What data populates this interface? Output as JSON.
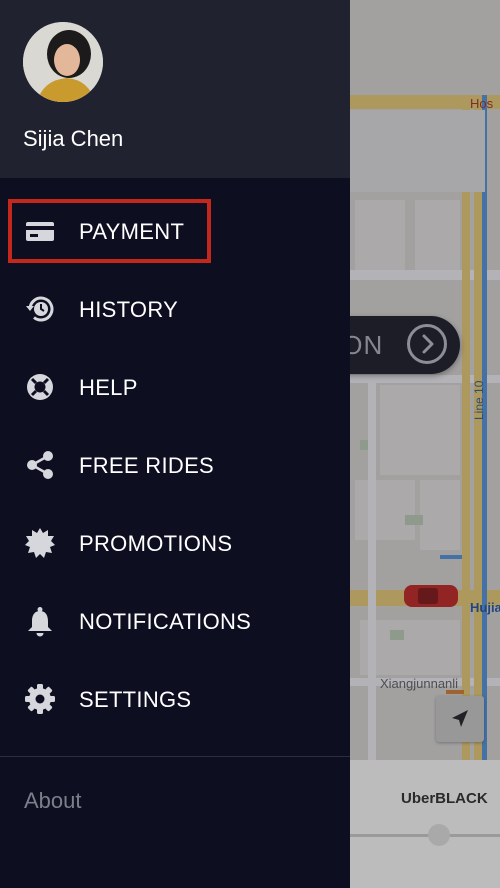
{
  "profile": {
    "name": "Sijia Chen"
  },
  "menu": [
    {
      "id": "payment",
      "label": "PAYMENT",
      "icon": "credit-card-icon",
      "highlighted": true
    },
    {
      "id": "history",
      "label": "HISTORY",
      "icon": "history-clock-icon"
    },
    {
      "id": "help",
      "label": "HELP",
      "icon": "lifebuoy-icon"
    },
    {
      "id": "free-rides",
      "label": "FREE RIDES",
      "icon": "share-icon"
    },
    {
      "id": "promotions",
      "label": "PROMOTIONS",
      "icon": "badge-burst-icon"
    },
    {
      "id": "notifications",
      "label": "NOTIFICATIONS",
      "icon": "bell-icon"
    },
    {
      "id": "settings",
      "label": "SETTINGS",
      "icon": "gear-icon"
    }
  ],
  "footer": {
    "about_label": "About"
  },
  "map": {
    "set_location_fragment": "ION",
    "labels": {
      "line10": "Line 10",
      "hujiale": "Hujial",
      "xiangjunnanli": "Xiangjunnanli",
      "hos": "Hos"
    }
  },
  "bottom_panel": {
    "vehicle_label": "UberBLACK"
  },
  "colors": {
    "drawer_bg": "#0d0e20",
    "header_bg": "#202230",
    "highlight": "#c4281c",
    "icon": "#d6d7dc",
    "about_text": "#7c7e8c"
  }
}
